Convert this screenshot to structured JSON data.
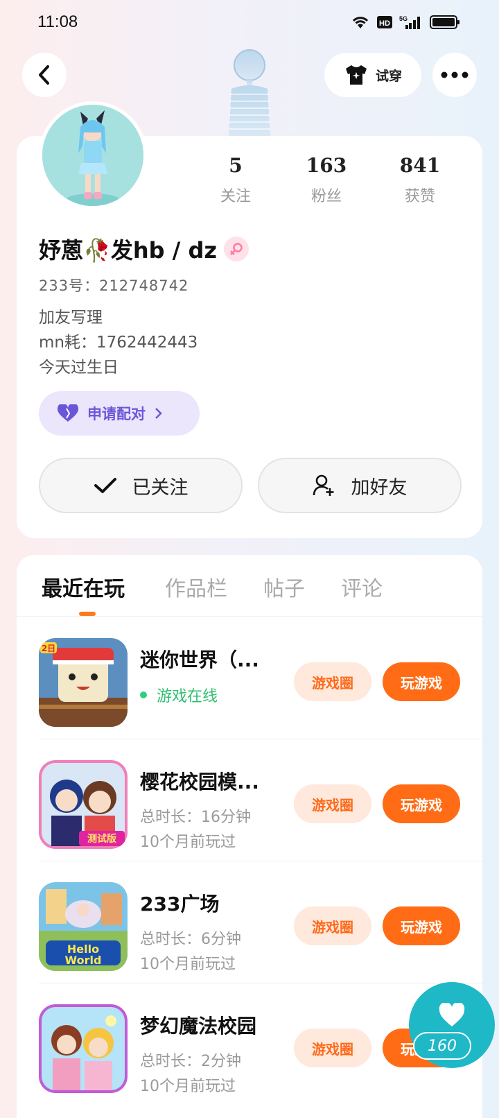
{
  "status_bar": {
    "time": "11:08"
  },
  "header": {
    "tryon_label": "试穿"
  },
  "profile": {
    "stats": [
      {
        "value": "5",
        "label": "关注"
      },
      {
        "value": "163",
        "label": "粉丝"
      },
      {
        "value": "841",
        "label": "获赞"
      }
    ],
    "name": "妤蒽🥀发hb / dz",
    "uid": "233号：212748742",
    "bio_lines": [
      "加友写理",
      "mn耗：1762442443",
      "今天过生日"
    ],
    "pair_label": "申请配对",
    "follow_label": "已关注",
    "add_friend_label": "加好友"
  },
  "tabs": [
    "最近在玩",
    "作品栏",
    "帖子",
    "评论"
  ],
  "games": [
    {
      "title": "迷你世界（...",
      "status": "游戏在线",
      "circle_label": "游戏圈",
      "play_label": "玩游戏"
    },
    {
      "title": "樱花校园模...",
      "duration": "总时长：16分钟",
      "last_played": "10个月前玩过",
      "circle_label": "游戏圈",
      "play_label": "玩游戏"
    },
    {
      "title": "233广场",
      "duration": "总时长：6分钟",
      "last_played": "10个月前玩过",
      "circle_label": "游戏圈",
      "play_label": "玩游戏"
    },
    {
      "title": "梦幻魔法校园",
      "duration": "总时长：2分钟",
      "last_played": "10个月前玩过",
      "circle_label": "游戏圈",
      "play_label": "玩游戏"
    }
  ],
  "fab": {
    "count": "160"
  },
  "icons": {
    "back": "chevron-left-icon",
    "tryon": "shirt-icon",
    "more": "more-dots-icon",
    "pair": "heart-icon",
    "follow": "check-icon",
    "add_friend": "add-user-icon",
    "fab": "heart-icon"
  },
  "colors": {
    "accent": "#ff6c15",
    "pair": "#6a56d9",
    "online": "#2fbf71",
    "fab": "#1fb8c7"
  }
}
